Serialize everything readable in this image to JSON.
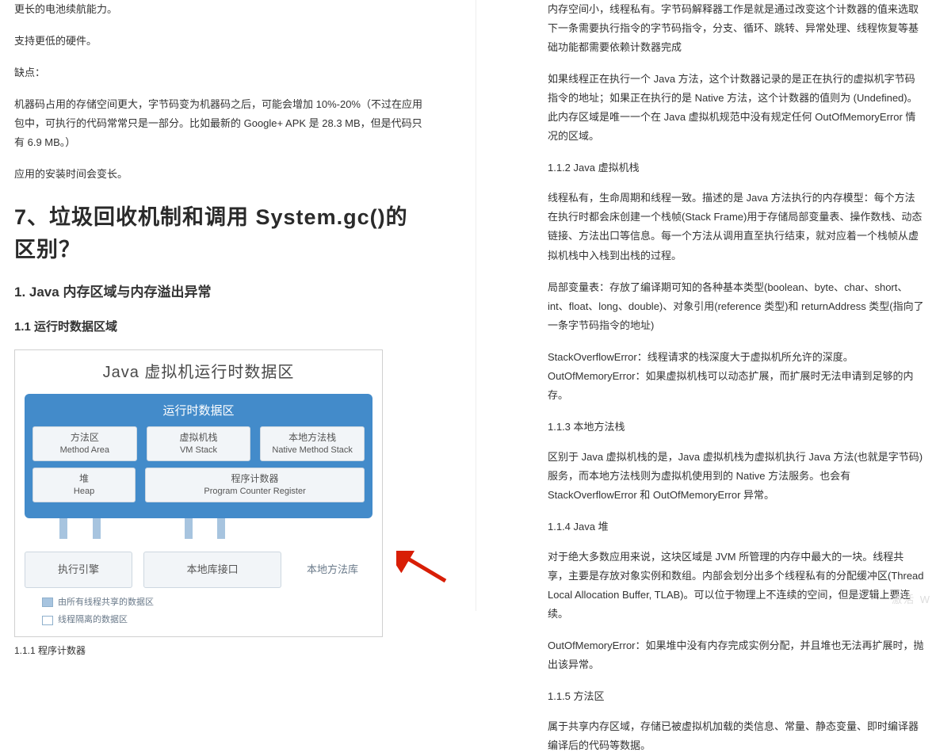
{
  "left": {
    "p1": "更长的电池续航能力。",
    "p2": "支持更低的硬件。",
    "p3": "缺点：",
    "p4": "机器码占用的存储空间更大，字节码变为机器码之后，可能会增加 10%-20%（不过在应用包中，可执行的代码常常只是一部分。比如最新的 Google+ APK 是 28.3 MB，但是代码只有 6.9 MB。）",
    "p5": "应用的安装时间会变长。",
    "h1": "7、垃圾回收机制和调用 System.gc()的区别？",
    "h2": "1. Java 内存区域与内存溢出异常",
    "h3": "1.1 运行时数据区域",
    "diagram": {
      "title": "Java 虚拟机运行时数据区",
      "runtime": "运行时数据区",
      "method_area_cn": "方法区",
      "method_area_en": "Method Area",
      "vm_stack_cn": "虚拟机栈",
      "vm_stack_en": "VM Stack",
      "native_stack_cn": "本地方法栈",
      "native_stack_en": "Native Method Stack",
      "heap_cn": "堆",
      "heap_en": "Heap",
      "pc_cn": "程序计数器",
      "pc_en": "Program Counter Register",
      "exec_engine": "执行引擎",
      "native_interface": "本地库接口",
      "native_lib": "本地方法库",
      "legend_shared": "由所有线程共享的数据区",
      "legend_private": "线程隔离的数据区"
    },
    "caption": "1.1.1 程序计数器"
  },
  "right": {
    "p1": "内存空间小，线程私有。字节码解释器工作是就是通过改变这个计数器的值来选取下一条需要执行指令的字节码指令，分支、循环、跳转、异常处理、线程恢复等基础功能都需要依赖计数器完成",
    "p2": "如果线程正在执行一个 Java 方法，这个计数器记录的是正在执行的虚拟机字节码指令的地址；如果正在执行的是 Native 方法，这个计数器的值则为 (Undefined)。此内存区域是唯一一个在 Java 虚拟机规范中没有规定任何 OutOfMemoryError 情况的区域。",
    "s1": "1.1.2 Java 虚拟机栈",
    "p3": "线程私有，生命周期和线程一致。描述的是 Java 方法执行的内存模型：每个方法在执行时都会床创建一个栈帧(Stack Frame)用于存储局部变量表、操作数栈、动态链接、方法出口等信息。每一个方法从调用直至执行结束，就对应着一个栈帧从虚拟机栈中入栈到出栈的过程。",
    "p4": "局部变量表：存放了编译期可知的各种基本类型(boolean、byte、char、short、int、float、long、double)、对象引用(reference 类型)和 returnAddress 类型(指向了一条字节码指令的地址)",
    "p5": "StackOverflowError：线程请求的栈深度大于虚拟机所允许的深度。\nOutOfMemoryError：如果虚拟机栈可以动态扩展，而扩展时无法申请到足够的内存。",
    "s2": "1.1.3 本地方法栈",
    "p6": "区别于 Java 虚拟机栈的是，Java 虚拟机栈为虚拟机执行 Java 方法(也就是字节码)服务，而本地方法栈则为虚拟机使用到的 Native 方法服务。也会有 StackOverflowError 和 OutOfMemoryError 异常。",
    "s3": "1.1.4 Java 堆",
    "p7": "对于绝大多数应用来说，这块区域是 JVM 所管理的内存中最大的一块。线程共享，主要是存放对象实例和数组。内部会划分出多个线程私有的分配缓冲区(Thread Local Allocation Buffer, TLAB)。可以位于物理上不连续的空间，但是逻辑上要连续。",
    "p8": "OutOfMemoryError：如果堆中没有内存完成实例分配，并且堆也无法再扩展时，抛出该异常。",
    "s4": "1.1.5 方法区",
    "p9": "属于共享内存区域，存储已被虚拟机加载的类信息、常量、静态变量、即时编译器编译后的代码等数据。"
  },
  "watermark": "激活 W"
}
